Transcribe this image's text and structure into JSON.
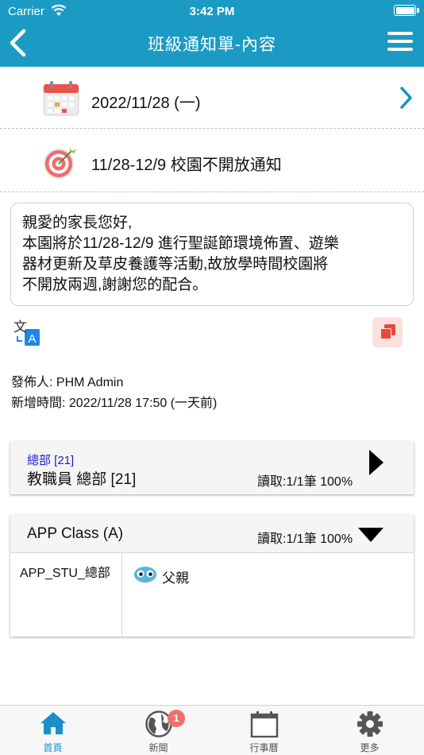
{
  "status_bar": {
    "carrier": "Carrier",
    "time": "3:42 PM"
  },
  "nav": {
    "title": "班級通知單-內容"
  },
  "notice": {
    "date": "2022/11/28 (一)",
    "title": "11/28-12/9 校園不開放通知",
    "body_lines": [
      "親愛的家長您好,",
      "本園將於11/28-12/9 進行聖誕節環境佈置、遊樂",
      "器材更新及草皮養護等活動,故放學時間校園將",
      "不開放兩週,謝謝您的配合。"
    ],
    "publisher": "發佈人: PHM Admin",
    "created": "新增時間: 2022/11/28 17:50 (一天前)"
  },
  "groups": [
    {
      "sub_label": "總部 [21]",
      "name": "教職員 總部 [21]",
      "read": "讀取:1/1筆 100%"
    },
    {
      "name": "APP Class (A)",
      "read": "讀取:1/1筆 100%",
      "student": "APP_STU_總部",
      "relation": "父親"
    }
  ],
  "tabs": [
    {
      "label": "首頁",
      "icon": "home-icon",
      "active": true
    },
    {
      "label": "新聞",
      "icon": "globe-icon",
      "badge": "1"
    },
    {
      "label": "行事曆",
      "icon": "calendar-icon"
    },
    {
      "label": "更多",
      "icon": "gear-icon"
    }
  ],
  "colors": {
    "header": "#1b9bc4",
    "accent": "#1b8fc7",
    "badge": "#ef6f6c",
    "copy": "#e8483a",
    "group_sub": "#1a1adb"
  }
}
